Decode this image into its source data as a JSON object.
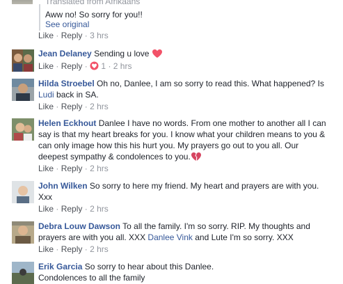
{
  "top": {
    "translated_label": "Translated from Afrikaans",
    "text": "Aww no! So sorry for you!!",
    "see_original": "See original",
    "like": "Like",
    "reply": "Reply",
    "time": "3 hrs"
  },
  "comments": [
    {
      "author": "Jean Delaney",
      "text": "Sending u love",
      "emoji": "red-heart",
      "like": "Like",
      "reply": "Reply",
      "reaction_count": "1",
      "time": "2 hrs"
    },
    {
      "author": "Hilda Stroebel",
      "text_a": "Oh no, Danlee, I am so sorry to read this. What happened? Is",
      "text_b": "Ludi back in SA.",
      "like": "Like",
      "reply": "Reply",
      "time": "2 hrs"
    },
    {
      "author": "Helen Eckhout",
      "text_a": "Danlee I have no words. From one mother to another all I can",
      "text_b": "say is that my heart breaks for you. I know what your children means to you &",
      "text_c": "can only image how this his hurt you. My prayers go out to you all. Our",
      "text_d": "deepest sympathy & condolences to you.",
      "emoji": "broken-heart",
      "like": "Like",
      "reply": "Reply",
      "time": "2 hrs"
    },
    {
      "author": "John Wilken",
      "text_a": "So sorry to here my friend. My heart and prayers are with you.",
      "text_b": "Xxx",
      "like": "Like",
      "reply": "Reply",
      "time": "2 hrs"
    },
    {
      "author": "Debra Louw Dawson",
      "text_a": "To all the family. I'm so sorry. RIP. My thoughts and",
      "text_b1": "prayers are with you all. XXX ",
      "mention": "Danlee Vink",
      "text_b2": " and Lute I'm so sorry. XXX",
      "like": "Like",
      "reply": "Reply",
      "time": "2 hrs"
    },
    {
      "author": "Erik Garcia",
      "text_a": "So sorry to hear about this Danlee.",
      "text_b": "Condolences to all the family"
    }
  ],
  "colors": {
    "link": "#365899",
    "meta": "#90949c",
    "action": "#4b4f56",
    "text": "#1d2129",
    "heart": "#f25268"
  }
}
